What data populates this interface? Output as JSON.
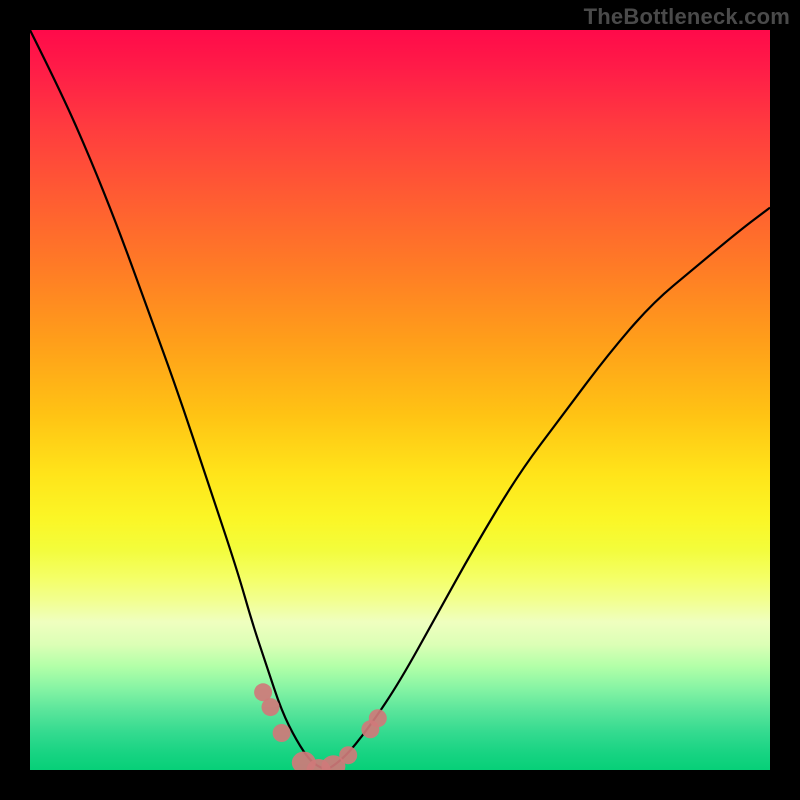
{
  "watermark": "TheBottleneck.com",
  "colors": {
    "frame": "#000000",
    "curve": "#000000",
    "marker": "#cf7a79",
    "gradient_top": "#ff0a4a",
    "gradient_bottom": "#07d078"
  },
  "chart_data": {
    "type": "line",
    "title": "",
    "xlabel": "",
    "ylabel": "",
    "xlim": [
      0,
      100
    ],
    "ylim": [
      0,
      100
    ],
    "x": [
      0,
      4,
      8,
      12,
      16,
      20,
      24,
      28,
      30,
      32,
      34,
      36,
      38,
      40,
      42,
      46,
      50,
      55,
      60,
      66,
      72,
      78,
      84,
      90,
      96,
      100
    ],
    "values": [
      100,
      92,
      83,
      73,
      62,
      51,
      39,
      27,
      20,
      14,
      8,
      4,
      1,
      0,
      1,
      6,
      12,
      21,
      30,
      40,
      48,
      56,
      63,
      68,
      73,
      76
    ],
    "markers": [
      {
        "x": 31.5,
        "y": 10.5
      },
      {
        "x": 32.5,
        "y": 8.5
      },
      {
        "x": 34.0,
        "y": 5.0
      },
      {
        "x": 37.0,
        "y": 1.0
      },
      {
        "x": 39.0,
        "y": 0.0
      },
      {
        "x": 41.0,
        "y": 0.5
      },
      {
        "x": 43.0,
        "y": 2.0
      },
      {
        "x": 46.0,
        "y": 5.5
      },
      {
        "x": 47.0,
        "y": 7.0
      }
    ]
  }
}
